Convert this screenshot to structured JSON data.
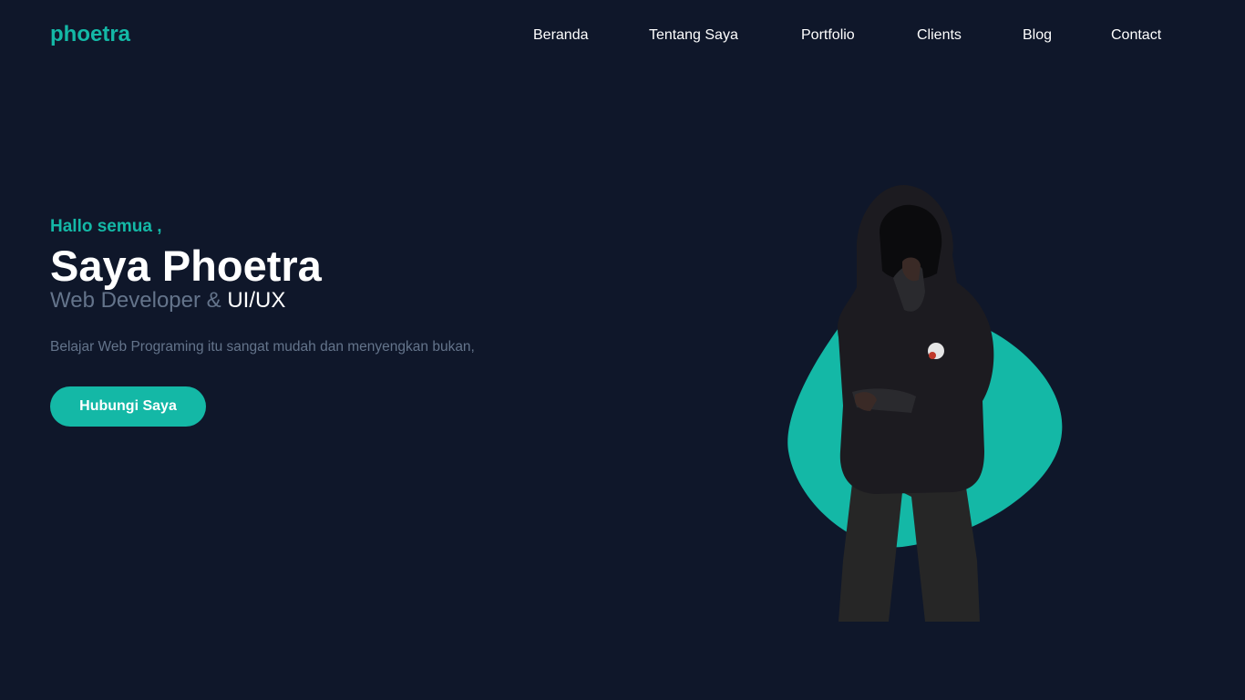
{
  "header": {
    "logo": "phoetra",
    "nav": [
      {
        "label": "Beranda"
      },
      {
        "label": "Tentang Saya"
      },
      {
        "label": "Portfolio"
      },
      {
        "label": "Clients"
      },
      {
        "label": "Blog"
      },
      {
        "label": "Contact"
      }
    ]
  },
  "hero": {
    "greeting": "Hallo semua ,",
    "title": "Saya Phoetra",
    "subtitle_prefix": "Web Developer &",
    "subtitle_accent": "UI/UX",
    "description": "Belajar Web Programing itu sangat mudah dan menyengkan bukan,",
    "cta_label": "Hubungi Saya"
  },
  "colors": {
    "background": "#0f172a",
    "accent": "#14b8a6",
    "muted_text": "#64748b",
    "text": "#ffffff"
  }
}
